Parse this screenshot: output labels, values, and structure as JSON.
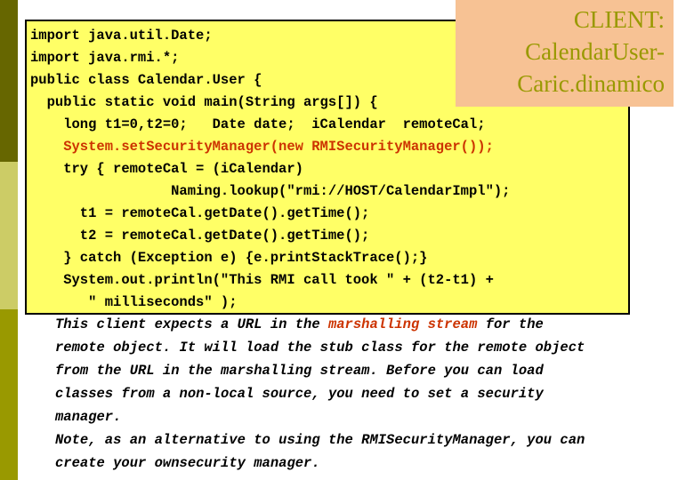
{
  "slide": {
    "title_box": {
      "background_color": "#f7c294",
      "text_color": "#999900",
      "lines": [
        "CLIENT:",
        "CalendarUser-",
        "Caric.dinamico"
      ]
    },
    "left_bar": {
      "segments": [
        {
          "name": "top-segment",
          "color": "#666600"
        },
        {
          "name": "middle-segment",
          "color": "#cccc66"
        },
        {
          "name": "bottom-segment",
          "color": "#999900"
        }
      ]
    },
    "code_box": {
      "background_color": "#ffff66",
      "border_color": "#000000",
      "text_color": "#000000",
      "highlight_color": "#cc3300",
      "language": "java",
      "lines": [
        {
          "text": "import java.util.Date;",
          "highlight": false
        },
        {
          "text": "import java.rmi.*;",
          "highlight": false
        },
        {
          "text": "public class Calendar.User {",
          "highlight": false
        },
        {
          "text": "  public static void main(String args[]) {",
          "highlight": false
        },
        {
          "text": "    long t1=0,t2=0;   Date date;  iCalendar  remoteCal;",
          "highlight": false
        },
        {
          "text": "    System.setSecurityManager(new RMISecurityManager());",
          "highlight": true
        },
        {
          "text": "    try { remoteCal = (iCalendar)",
          "highlight": false
        },
        {
          "text": "                 Naming.lookup(\"rmi://HOST/CalendarImpl\");",
          "highlight": false
        },
        {
          "text": "      t1 = remoteCal.getDate().getTime();",
          "highlight": false
        },
        {
          "text": "      t2 = remoteCal.getDate().getTime();",
          "highlight": false
        },
        {
          "text": "    } catch (Exception e) {e.printStackTrace();}",
          "highlight": false
        },
        {
          "text": "    System.out.println(\"This RMI call took \" + (t2-t1) +",
          "highlight": false
        },
        {
          "text": "       \" milliseconds\" );",
          "highlight": false
        },
        {
          "text": "   }",
          "highlight": false
        },
        {
          "text": "  }",
          "highlight": false
        }
      ]
    },
    "description": {
      "text_color": "#000000",
      "highlight_color": "#cc3300",
      "lines": [
        {
          "segments": [
            {
              "text": "This client expects a URL in the ",
              "highlight": false
            },
            {
              "text": "marshalling stream",
              "highlight": true
            },
            {
              "text": " for the",
              "highlight": false
            }
          ]
        },
        {
          "segments": [
            {
              "text": "remote object. It will load the stub class for the remote object",
              "highlight": false
            }
          ]
        },
        {
          "segments": [
            {
              "text": "from the URL in the marshalling stream. Before you can load",
              "highlight": false
            }
          ]
        },
        {
          "segments": [
            {
              "text": "classes from a non-local source, you need to set a security",
              "highlight": false
            }
          ]
        },
        {
          "segments": [
            {
              "text": "manager.",
              "highlight": false
            }
          ]
        },
        {
          "segments": [
            {
              "text": "Note, as an alternative to using the RMISecurityManager, you can",
              "highlight": false
            }
          ]
        },
        {
          "segments": [
            {
              "text": "create your ownsecurity manager.",
              "highlight": false
            }
          ]
        }
      ]
    }
  }
}
